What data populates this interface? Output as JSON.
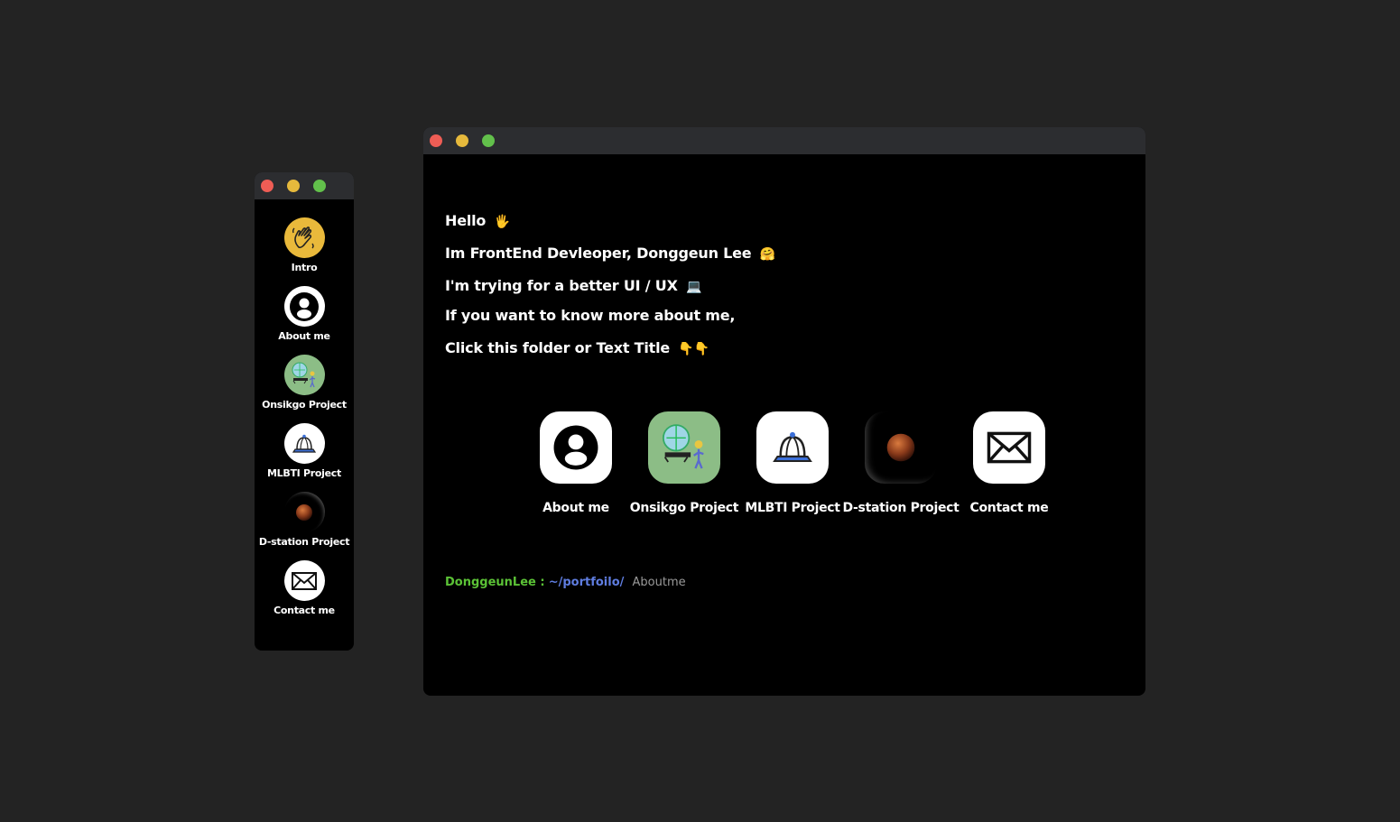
{
  "dock": {
    "items": [
      {
        "label": "Intro",
        "icon": "waving-hand-icon"
      },
      {
        "label": "About me",
        "icon": "user-circle-icon"
      },
      {
        "label": "Onsikgo Project",
        "icon": "onsikgo-logo-icon"
      },
      {
        "label": "MLBTI Project",
        "icon": "cap-icon"
      },
      {
        "label": "D-station Project",
        "icon": "moon-icon"
      },
      {
        "label": "Contact me",
        "icon": "mail-icon"
      }
    ]
  },
  "window": {
    "intro": {
      "line1": "Hello",
      "line1_emoji": "🖐",
      "line2": "Im FrontEnd Devleoper, Donggeun Lee",
      "line2_emoji": "🤗",
      "line3": "I'm trying for a better UI / UX",
      "line3_emoji": "💻",
      "line4": "If you want to know more about me,",
      "line5": "Click this folder or Text Title",
      "line5_emoji": "👇👇"
    },
    "folders": [
      {
        "label": "About me",
        "icon": "user-circle-icon"
      },
      {
        "label": "Onsikgo Project",
        "icon": "onsikgo-logo-icon"
      },
      {
        "label": "MLBTI Project",
        "icon": "cap-icon"
      },
      {
        "label": "D-station Project",
        "icon": "moon-icon"
      },
      {
        "label": "Contact me",
        "icon": "mail-icon"
      }
    ],
    "prompt": {
      "user": "DonggeunLee :",
      "path": "~/portfoilo/",
      "command": "Aboutme"
    }
  },
  "colors": {
    "background": "#232323",
    "window": "#000000",
    "titlebar": "#2c2d30",
    "close": "#ee5d55",
    "minimize": "#e6b93c",
    "maximize": "#62c04b",
    "prompt_user": "#5bc236",
    "prompt_path": "#5f7de0"
  }
}
